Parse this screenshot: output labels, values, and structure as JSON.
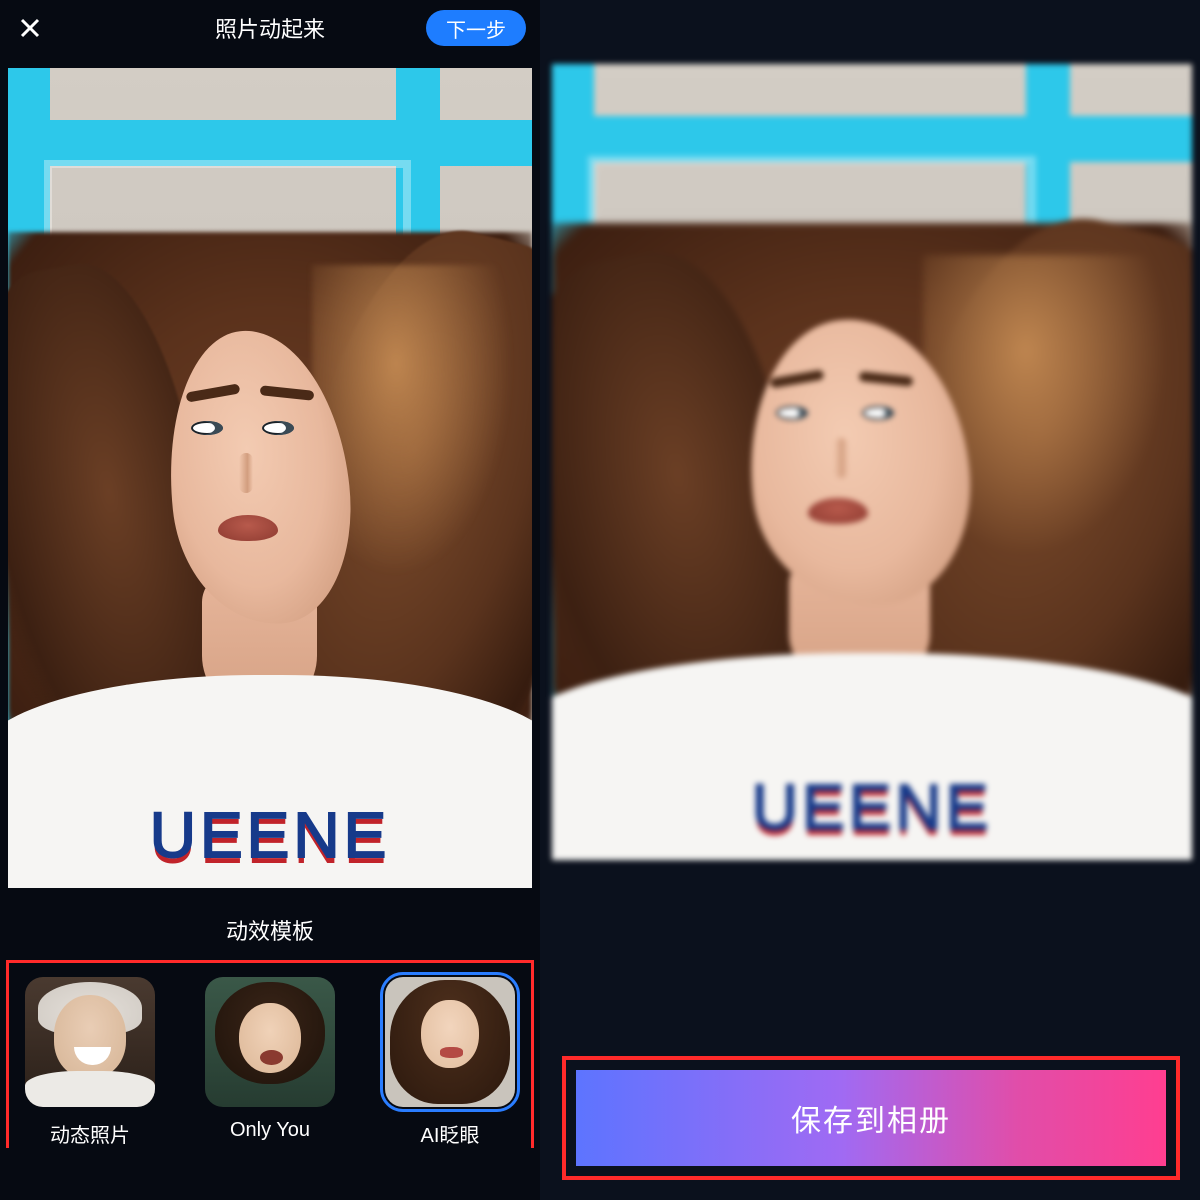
{
  "header": {
    "title": "照片动起来",
    "next_label": "下一步"
  },
  "section": {
    "templates_label": "动效模板"
  },
  "templates": [
    {
      "label": "动态照片",
      "selected": false
    },
    {
      "label": "Only You",
      "selected": false
    },
    {
      "label": "AI眨眼",
      "selected": true
    }
  ],
  "shirt_text": "UEENE",
  "right": {
    "save_label": "保存到相册"
  }
}
